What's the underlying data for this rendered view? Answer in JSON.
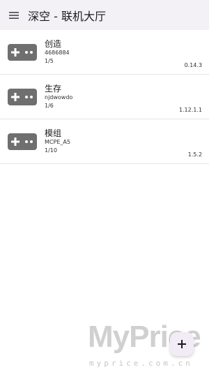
{
  "app_bar": {
    "title": "深空 - 联机大厅",
    "menu_icon": "hamburger-menu-icon"
  },
  "rooms": [
    {
      "name": "创造",
      "host": "4686884",
      "players": "1/5",
      "version": "0.14.3",
      "icon": "gamepad-icon"
    },
    {
      "name": "生存",
      "host": "njdwowdo",
      "players": "1/6",
      "version": "1.12.1.1",
      "icon": "gamepad-icon"
    },
    {
      "name": "模组",
      "host": "MCPE_A5",
      "players": "1/10",
      "version": "1.5.2",
      "icon": "gamepad-icon"
    }
  ],
  "fab": {
    "label": "+",
    "icon": "plus-icon"
  },
  "watermark": {
    "title": "MyPrice",
    "url": "myprice.com.cn"
  },
  "colors": {
    "app_bar_bg": "#f4f1f6",
    "icon_gray": "#6f6f6f",
    "divider": "#e6e6e6",
    "fab_bg": "#f2ecf6"
  }
}
